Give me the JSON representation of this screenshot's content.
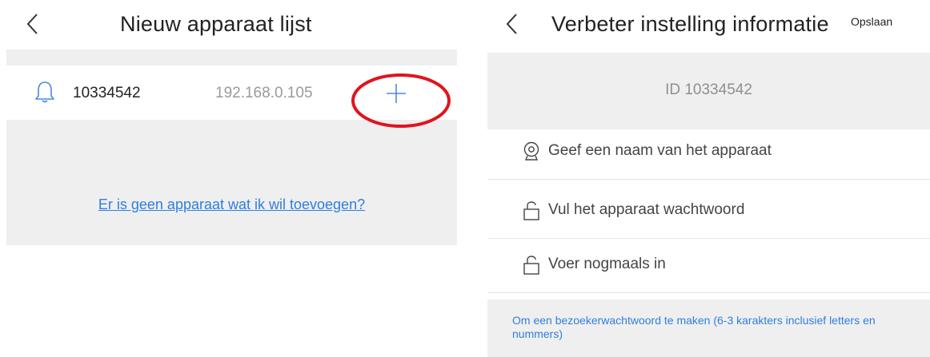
{
  "left": {
    "title": "Nieuw apparaat lijst",
    "device": {
      "id": "10334542",
      "ip": "192.168.0.105"
    },
    "help_link": "Er is geen apparaat wat ik wil toevoegen?"
  },
  "right": {
    "title": "Verbeter instelling informatie",
    "save_label": "Opslaan",
    "device_id": "ID 10334542",
    "fields": [
      {
        "placeholder": "Geef een naam van het apparaat",
        "icon": "camera-icon"
      },
      {
        "placeholder": "Vul het apparaat wachtwoord",
        "icon": "lock-icon"
      },
      {
        "placeholder": "Voer nogmaals in",
        "icon": "lock-icon"
      }
    ],
    "note": "Om een bezoekerwachtwoord te maken (6-3 karakters inclusief letters en nummers)"
  },
  "colors": {
    "accent": "#2f7ee0",
    "highlight_circle": "#e0141e",
    "background_gray": "#efefef"
  }
}
